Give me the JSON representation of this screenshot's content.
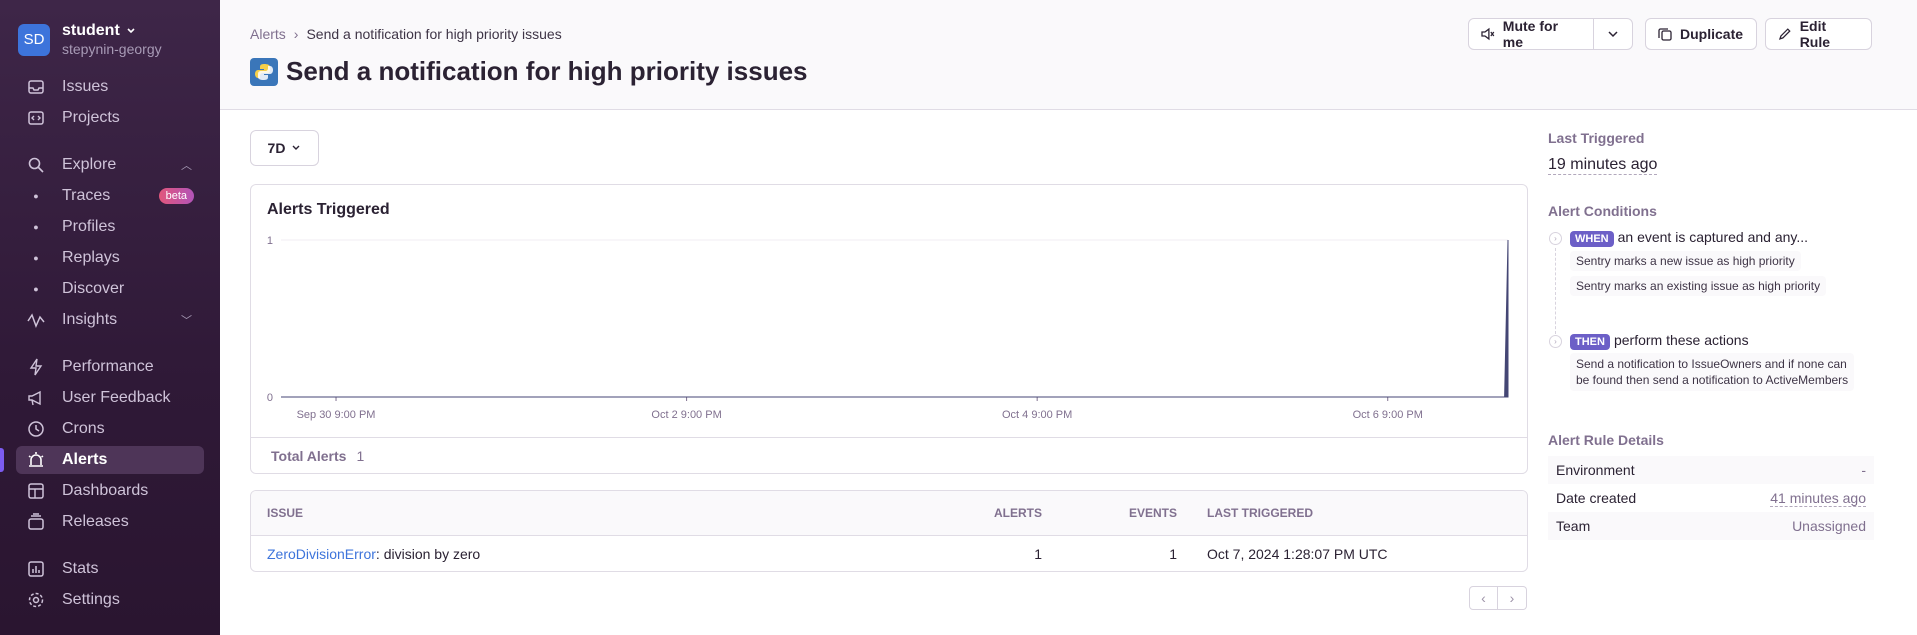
{
  "sidebar": {
    "org_initials": "SD",
    "org_name": "student",
    "org_user": "stepynin-georgy",
    "items": [
      {
        "label": "Issues",
        "icon": "inbox-icon"
      },
      {
        "label": "Projects",
        "icon": "code-icon"
      },
      {
        "label": "Explore",
        "icon": "search-icon"
      },
      {
        "label": "Traces",
        "badge": "beta"
      },
      {
        "label": "Profiles"
      },
      {
        "label": "Replays"
      },
      {
        "label": "Discover"
      },
      {
        "label": "Insights",
        "icon": "graph-icon"
      },
      {
        "label": "Performance",
        "icon": "lightning-icon"
      },
      {
        "label": "User Feedback",
        "icon": "megaphone-icon"
      },
      {
        "label": "Crons",
        "icon": "clock-icon"
      },
      {
        "label": "Alerts",
        "icon": "siren-icon",
        "active": true
      },
      {
        "label": "Dashboards",
        "icon": "dashboard-icon"
      },
      {
        "label": "Releases",
        "icon": "releases-icon"
      },
      {
        "label": "Stats",
        "icon": "stats-icon"
      },
      {
        "label": "Settings",
        "icon": "gear-icon"
      }
    ]
  },
  "header": {
    "breadcrumb_root": "Alerts",
    "breadcrumb_current": "Send a notification for high priority issues",
    "title": "Send a notification for high priority issues",
    "mute_label": "Mute for me",
    "duplicate_label": "Duplicate",
    "edit_label": "Edit Rule"
  },
  "main": {
    "range_label": "7D",
    "chart_title": "Alerts Triggered",
    "total_label": "Total Alerts",
    "total_value": "1",
    "table": {
      "headers": [
        "ISSUE",
        "ALERTS",
        "EVENTS",
        "LAST TRIGGERED"
      ],
      "rows": [
        {
          "issue_type": "ZeroDivisionError",
          "issue_msg": ": division by zero",
          "alerts": "1",
          "events": "1",
          "last": "Oct 7, 2024 1:28:07 PM UTC"
        }
      ]
    }
  },
  "chart_data": {
    "type": "area",
    "title": "Alerts Triggered",
    "x_tick_labels": [
      "Sep 30 9:00 PM",
      "Oct 2 9:00 PM",
      "Oct 4 9:00 PM",
      "Oct 6 9:00 PM"
    ],
    "y_tick_labels": [
      "0",
      "1"
    ],
    "ylim": [
      0,
      1
    ],
    "xlim": [
      "Sep 30 2024 13:28",
      "Oct 7 2024 13:28"
    ],
    "points": [
      {
        "x": "Sep 30 2024 13:28",
        "y": 0
      },
      {
        "x": "Oct 7 2024 13:00",
        "y": 0
      },
      {
        "x": "Oct 7 2024 13:28",
        "y": 1
      }
    ],
    "color": "#444674"
  },
  "right": {
    "last_triggered_label": "Last Triggered",
    "last_triggered_value": "19 minutes ago",
    "conditions_label": "Alert Conditions",
    "when_badge": "WHEN",
    "when_text": "an event is captured and any...",
    "when_items": [
      "Sentry marks a new issue as high priority",
      "Sentry marks an existing issue as high priority"
    ],
    "then_badge": "THEN",
    "then_text": "perform these actions",
    "then_item_line1": "Send a notification to IssueOwners and if none can",
    "then_item_line2": "be found then send a notification to ActiveMembers",
    "details_label": "Alert Rule Details",
    "details": [
      {
        "key": "Environment",
        "value": "-"
      },
      {
        "key": "Date created",
        "value": "41 minutes ago"
      },
      {
        "key": "Team",
        "value": "Unassigned"
      }
    ]
  }
}
